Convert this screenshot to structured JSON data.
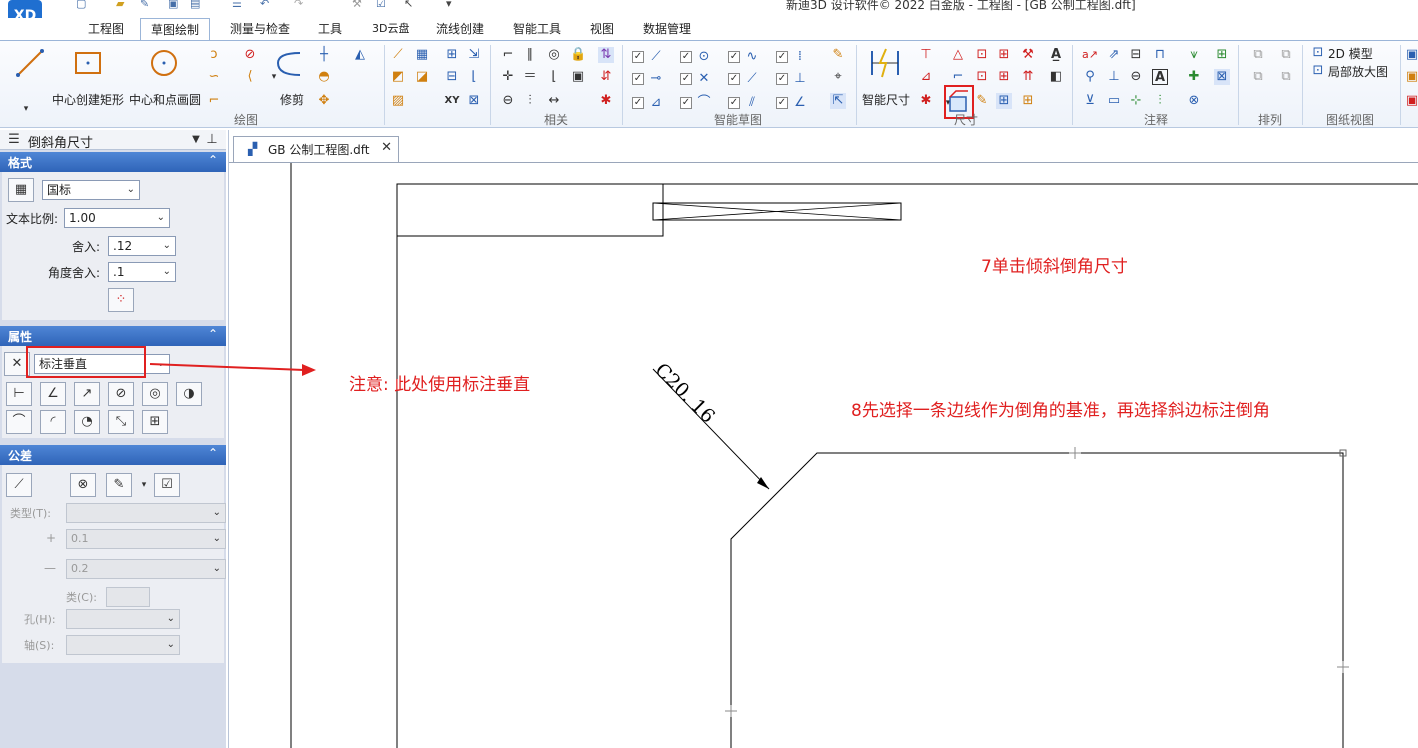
{
  "window": {
    "title": "新迪3D 设计软件© 2022 白金版 - 工程图 - [GB 公制工程图.dft]",
    "logo_text": "XD"
  },
  "menu_tabs": [
    "工程图",
    "草图绘制",
    "测量与检查",
    "工具",
    "3D云盘",
    "流线创建",
    "智能工具",
    "视图",
    "数据管理"
  ],
  "ribbon": {
    "draw_group": {
      "label": "绘图",
      "line_label": "",
      "center_rect_label": "中心创建矩形",
      "center_circle_label": "中心和点画圆",
      "trim_label": "修剪"
    },
    "relate_group": {
      "label": "相关"
    },
    "smart_sketch_group": {
      "label": "智能草图"
    },
    "dimension_group": {
      "label": "尺寸",
      "smart_dim_label": "智能尺寸"
    },
    "annotation_group": {
      "label": "注释"
    },
    "arrange_group": {
      "label": "排列"
    },
    "sheet_view_group": {
      "label": "图纸视图",
      "model_2d_label": "2D 模型",
      "detail_view_label": "局部放大图"
    }
  },
  "left_panel": {
    "title": "倒斜角尺寸",
    "format": {
      "header": "格式",
      "style_value": "国标",
      "text_scale_label": "文本比例:",
      "text_scale_value": "1.00",
      "round_label": "舍入:",
      "round_value": ".12",
      "angle_round_label": "角度舍入:",
      "angle_round_value": ".1"
    },
    "properties": {
      "header": "属性",
      "mode_value": "标注垂直"
    },
    "tolerance": {
      "header": "公差",
      "type_label": "类型(T):",
      "plus_label": "+",
      "plus_value": "0.1",
      "minus_label": "—",
      "minus_value": "0.2",
      "class_label": "类(C):",
      "hole_label": "孔(H):",
      "shaft_label": "轴(S):"
    }
  },
  "document": {
    "tab_label": "GB 公制工程图.dft",
    "dimension_text": "C20. 16"
  },
  "annotations": {
    "step7": "7单击倾斜倒角尺寸",
    "note": "注意:  此处使用标注垂直",
    "step8": "8先选择一条边线作为倒角的基准，再选择斜边标注倒角"
  }
}
